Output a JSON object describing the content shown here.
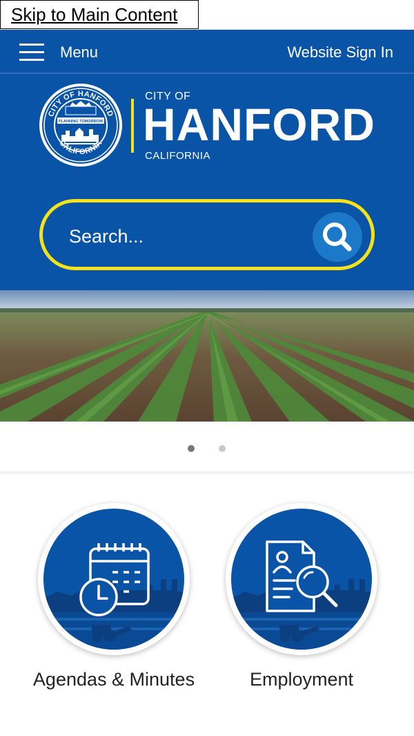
{
  "skip_link": "Skip to Main Content",
  "topbar": {
    "menu_icon": "hamburger-icon",
    "menu_label": "Menu",
    "sign_in": "Website Sign In"
  },
  "logo": {
    "seal_icon": "city-seal-icon",
    "seal_text_top": "CITY OF HANFORD",
    "seal_text_bottom": "CALIFORNIA",
    "seal_ribbon": "PLANNING TOMORROW",
    "city_of": "CITY OF",
    "name": "HANFORD",
    "state": "CALIFORNIA"
  },
  "search": {
    "placeholder": "Search...",
    "icon": "search-icon"
  },
  "hero": {
    "slides": 2,
    "active_slide": 1
  },
  "tiles": [
    {
      "label": "Agendas & Minutes",
      "icon": "calendar-clock-icon"
    },
    {
      "label": "Employment",
      "icon": "document-search-icon"
    }
  ],
  "colors": {
    "brand_blue": "#0954a6",
    "accent_yellow": "#f5e21a",
    "search_button": "#1c78c8"
  }
}
